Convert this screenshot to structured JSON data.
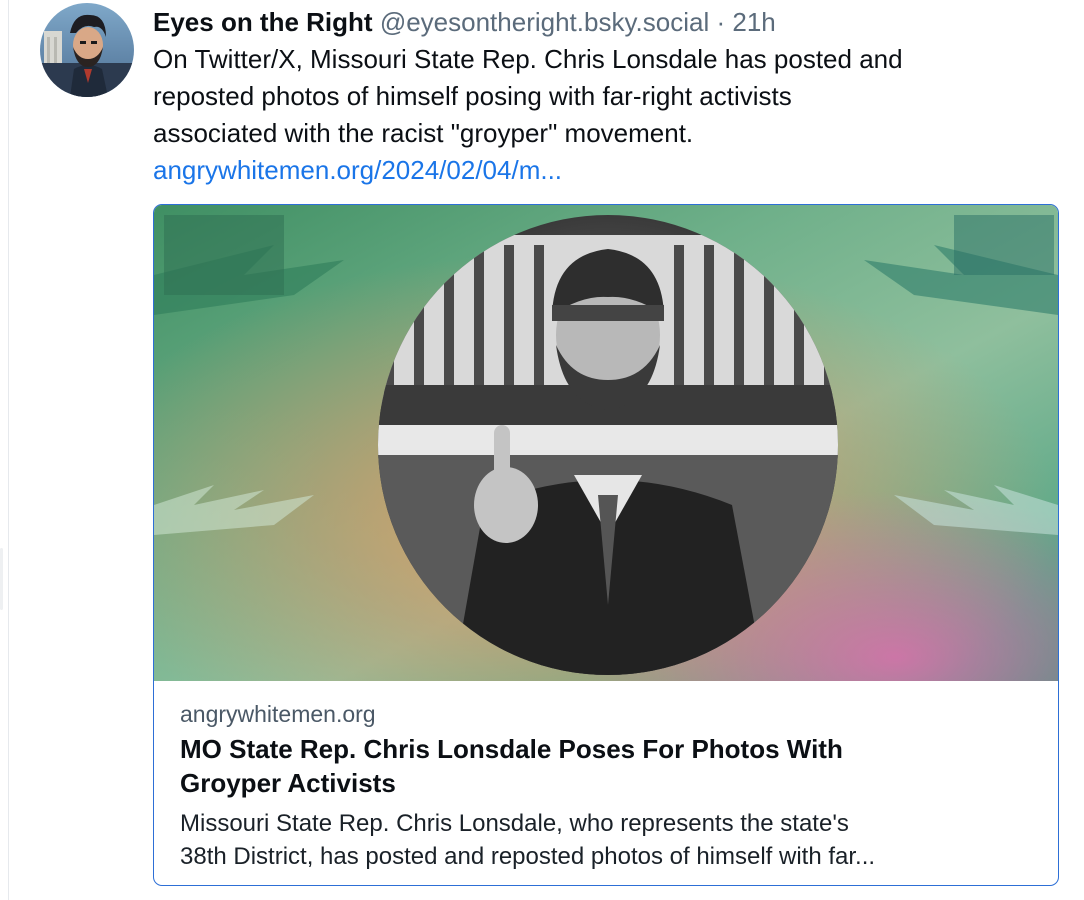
{
  "post": {
    "author": {
      "display_name": "Eyes on the Right",
      "handle": "@eyesontheright.bsky.social",
      "separator": "·",
      "time": "21h"
    },
    "text_lines": [
      "On Twitter/X, Missouri State Rep. Chris Lonsdale has posted and",
      "reposted photos of himself posing with far-right activists",
      "associated with the racist \"groyper\" movement."
    ],
    "link": "angrywhitemen.org/2024/02/04/m..."
  },
  "link_card": {
    "domain": "angrywhitemen.org",
    "title_lines": [
      "MO State Rep. Chris Lonsdale Poses For Photos With",
      "Groyper Activists"
    ],
    "description_lines": [
      "Missouri State Rep. Chris Lonsdale, who represents the state's",
      "38th District, has posted and reposted photos of himself with far..."
    ]
  },
  "colors": {
    "link": "#1a75e8",
    "card_border": "#2d6fd6",
    "muted_text": "#5b6b7b"
  }
}
